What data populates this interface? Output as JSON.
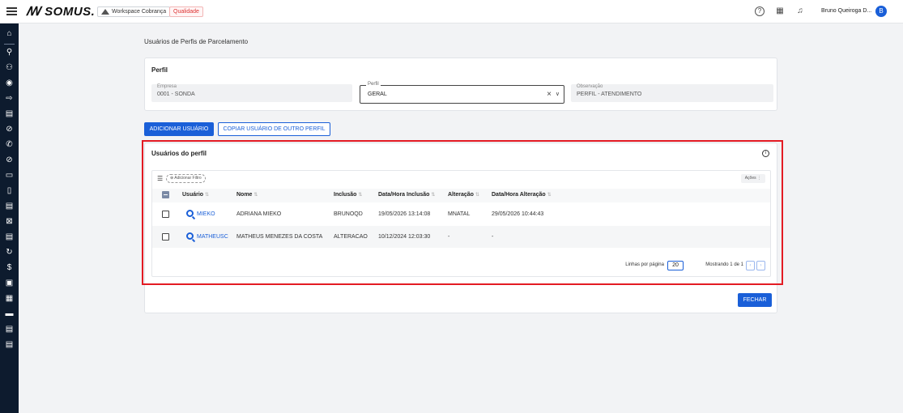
{
  "topbar": {
    "logo": "ꟿ SOMUS.",
    "workspace": "Workspace Cobrança",
    "environment": "Qualidade",
    "user_name": "Bruno Queiroga D...",
    "avatar_initial": "B"
  },
  "sidebar": {
    "icons": [
      "home-icon",
      "search-icon",
      "users-icon",
      "target-icon",
      "login-icon",
      "calculator-icon",
      "no-phone-icon",
      "phone-icon",
      "block-icon",
      "card-icon",
      "tablet-icon",
      "document-icon",
      "image-off-icon",
      "list-icon",
      "refresh-icon",
      "dollar-icon",
      "id-card-icon",
      "calendar-icon",
      "cash-icon",
      "form-icon",
      "report-icon"
    ]
  },
  "page": {
    "title": "Usuários de Perfis de Parcelamento"
  },
  "perfil": {
    "title": "Perfil",
    "empresa_label": "Empresa",
    "empresa_value": "0001 - SONDA",
    "perfil_label": "Perfil",
    "perfil_value": "GERAL",
    "observacao_label": "Observação",
    "observacao_value": "PERFIL - ATENDIMENTO"
  },
  "actions": {
    "add_user": "ADICIONAR USUÁRIO",
    "copy_user": "COPIAR USUÁRIO DE OUTRO PERFIL",
    "close": "FECHAR"
  },
  "users": {
    "title": "Usuários do perfil",
    "add_filter": "⊕ Adicionar Filtro",
    "acoes": "Ações ⋮",
    "columns": [
      "Usuário",
      "Nome",
      "Inclusão",
      "Data/Hora Inclusão",
      "Alteração",
      "Data/Hora Alteração"
    ],
    "rows": [
      [
        "MIEKO",
        "ADRIANA MIEKO",
        "BRUNOQD",
        "19/05/2026 13:14:08",
        "MNATAL",
        "29/05/2026 10:44:43"
      ],
      [
        "MATHEUSC",
        "MATHEUS MENEZES DA COSTA",
        "ALTERACAO",
        "10/12/2024 12:03:30",
        "-",
        "-"
      ]
    ],
    "rows_per_page_label": "Linhas por página",
    "rows_per_page": "20",
    "showing": "Mostrando 1 de 1"
  }
}
